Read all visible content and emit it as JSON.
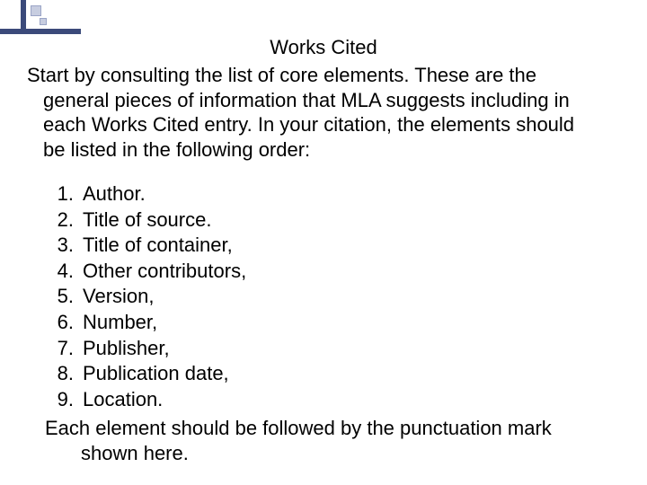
{
  "title": "Works Cited",
  "intro_line1": "Start by consulting the list of core elements. These are the",
  "intro_line2": "general pieces of information that MLA suggests including in",
  "intro_line3": "each Works Cited entry. In your citation, the elements should",
  "intro_line4": "be listed in the following order:",
  "list": [
    {
      "n": "1.",
      "text": "Author."
    },
    {
      "n": "2.",
      "text": "Title of source."
    },
    {
      "n": "3.",
      "text": "Title of container,"
    },
    {
      "n": "4.",
      "text": "Other contributors,"
    },
    {
      "n": "5.",
      "text": "Version,"
    },
    {
      "n": "6.",
      "text": "Number,"
    },
    {
      "n": "7.",
      "text": "Publisher,"
    },
    {
      "n": "8.",
      "text": "Publication date,"
    },
    {
      "n": "9.",
      "text": "Location."
    }
  ],
  "closing_line1": "Each element should be followed by the punctuation mark",
  "closing_line2": "shown here."
}
